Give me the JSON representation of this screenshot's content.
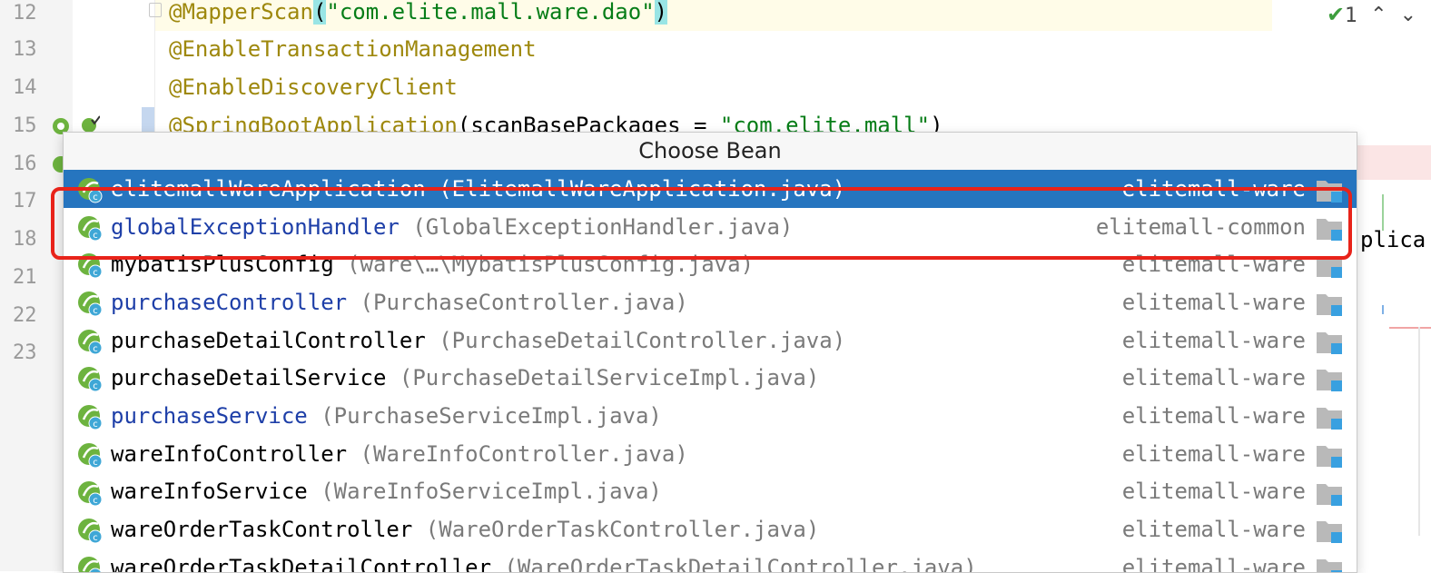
{
  "editor": {
    "line_numbers": [
      "12",
      "13",
      "14",
      "15",
      "16",
      "17",
      "18",
      "21",
      "22",
      "23"
    ],
    "code": {
      "l12_ann": "@MapperScan",
      "l12_open": "(",
      "l12_str": "\"com.elite.mall.ware.dao\"",
      "l12_close": ")",
      "l13": "@EnableTransactionManagement",
      "l14": "@EnableDiscoveryClient",
      "l15_ann": "@SpringBootApplication",
      "l15_mid": "(scanBasePackages = ",
      "l15_str": "\"com.elite.mall\"",
      "l15_close": ")"
    },
    "right_side_text": "plica",
    "inspection": {
      "count": "1"
    }
  },
  "popup": {
    "title": "Choose Bean",
    "rows": [
      {
        "name": "elitemallWareApplication",
        "file": "(ElitemallWareApplication.java)",
        "module": "elitemall-ware",
        "selected": true,
        "link": false
      },
      {
        "name": "globalExceptionHandler",
        "file": "(GlobalExceptionHandler.java)",
        "module": "elitemall-common",
        "selected": false,
        "link": true
      },
      {
        "name": "mybatisPlusConfig",
        "file": "(ware\\…\\MybatisPlusConfig.java)",
        "module": "elitemall-ware",
        "selected": false,
        "link": false
      },
      {
        "name": "purchaseController",
        "file": "(PurchaseController.java)",
        "module": "elitemall-ware",
        "selected": false,
        "link": true
      },
      {
        "name": "purchaseDetailController",
        "file": "(PurchaseDetailController.java)",
        "module": "elitemall-ware",
        "selected": false,
        "link": false
      },
      {
        "name": "purchaseDetailService",
        "file": "(PurchaseDetailServiceImpl.java)",
        "module": "elitemall-ware",
        "selected": false,
        "link": false
      },
      {
        "name": "purchaseService",
        "file": "(PurchaseServiceImpl.java)",
        "module": "elitemall-ware",
        "selected": false,
        "link": true
      },
      {
        "name": "wareInfoController",
        "file": "(WareInfoController.java)",
        "module": "elitemall-ware",
        "selected": false,
        "link": false
      },
      {
        "name": "wareInfoService",
        "file": "(WareInfoServiceImpl.java)",
        "module": "elitemall-ware",
        "selected": false,
        "link": false
      },
      {
        "name": "wareOrderTaskController",
        "file": "(WareOrderTaskController.java)",
        "module": "elitemall-ware",
        "selected": false,
        "link": false
      },
      {
        "name": "wareOrderTaskDetailController",
        "file": "(WareOrderTaskDetailController.java)",
        "module": "elitemall-ware",
        "selected": false,
        "link": false
      }
    ]
  },
  "colors": {
    "selection": "#2675bf",
    "annotation_box": "#e8231a",
    "annotation": "#9e880d",
    "string": "#067d17"
  },
  "icons": {
    "bean": "spring-bean-icon",
    "folder": "module-folder-icon"
  }
}
